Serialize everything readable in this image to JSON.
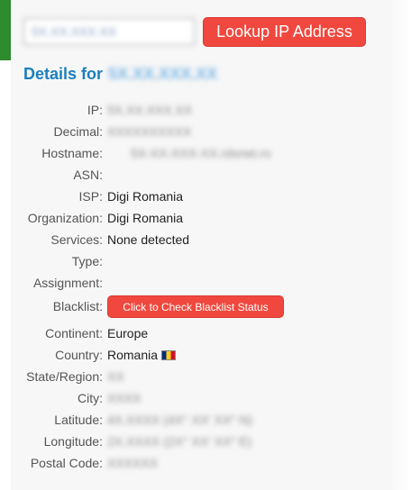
{
  "colors": {
    "accent": "#f0483e",
    "title": "#1a7fbd",
    "green_bar": "#2e8b2e"
  },
  "search": {
    "value": "5X.XX.XXX.XX",
    "button_label": "Lookup IP Address"
  },
  "details": {
    "title_prefix": "Details for",
    "title_ip": "5X.XX.XXX.XX",
    "rows": [
      {
        "label": "IP:",
        "value": "5X.XX.XXX.XX",
        "blurred": true
      },
      {
        "label": "Decimal:",
        "value": "XXXXXXXXXX",
        "blurred": true
      },
      {
        "label": "Hostname:",
        "value": "5X-XX-XXX-XX.rdsnet.ro",
        "blurred": true
      },
      {
        "label": "ASN:",
        "value": ""
      },
      {
        "label": "ISP:",
        "value": "Digi Romania"
      },
      {
        "label": "Organization:",
        "value": "Digi Romania"
      },
      {
        "label": "Services:",
        "value": "None detected"
      },
      {
        "label": "Type:",
        "value": ""
      },
      {
        "label": "Assignment:",
        "value": ""
      },
      {
        "label": "Blacklist:",
        "button": "Click to Check Blacklist Status"
      },
      {
        "label": "Continent:",
        "value": "Europe"
      },
      {
        "label": "Country:",
        "value": "Romania",
        "flag": "romania-flag-icon"
      },
      {
        "label": "State/Region:",
        "value": "XX",
        "blurred": true
      },
      {
        "label": "City:",
        "value": "XXXX",
        "blurred": true
      },
      {
        "label": "Latitude:",
        "value": "4X.XXXX  (4X° XX′ XX″ N)",
        "blurred": true
      },
      {
        "label": "Longitude:",
        "value": "2X.XXXX  (2X° XX′ XX″ E)",
        "blurred": true
      },
      {
        "label": "Postal Code:",
        "value": "XXXXXX",
        "blurred": true
      }
    ]
  }
}
